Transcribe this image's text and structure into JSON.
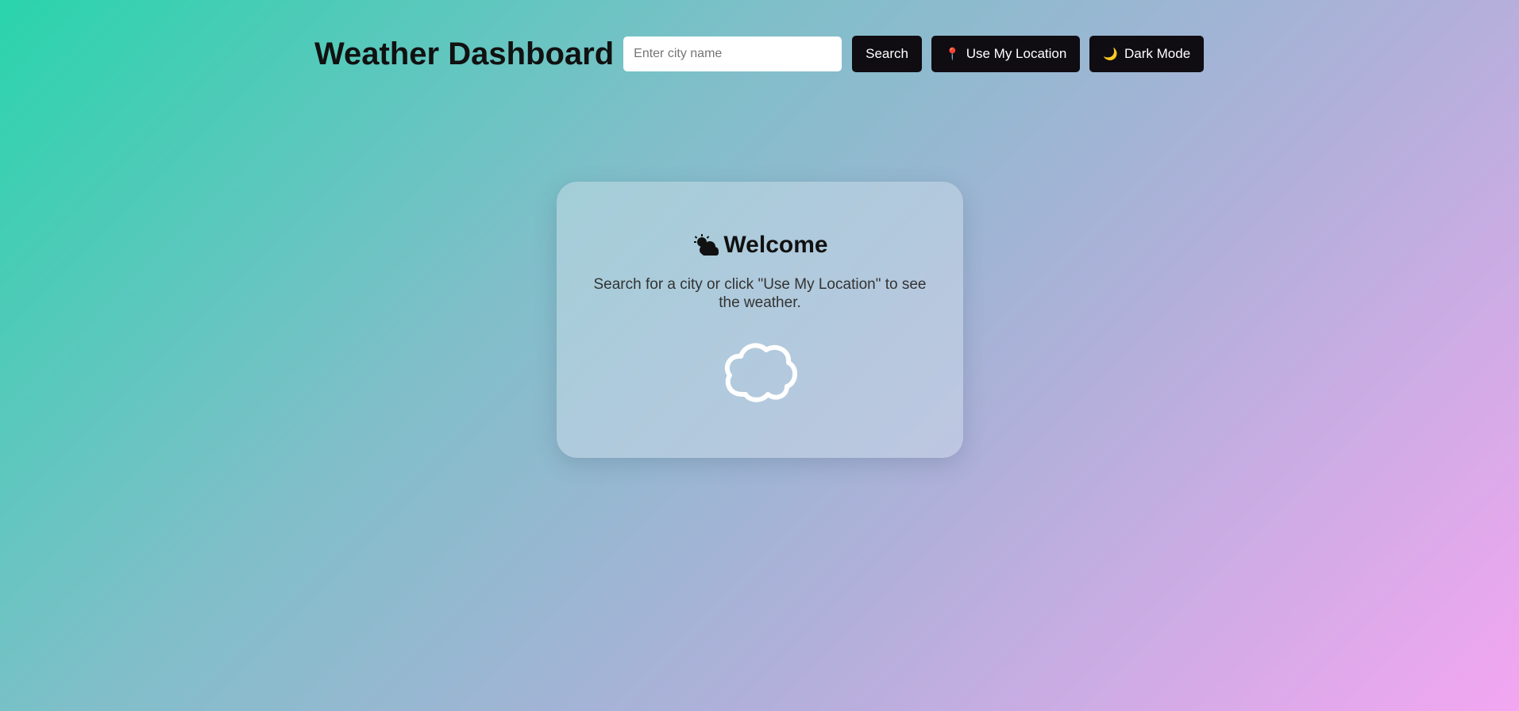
{
  "header": {
    "title": "Weather Dashboard",
    "search_placeholder": "Enter city name",
    "search_value": "",
    "search_button_label": "Search",
    "location_button_label": "Use My Location",
    "location_icon": "pin-icon",
    "dark_mode_button_label": "Dark Mode",
    "dark_mode_icon": "moon-icon"
  },
  "welcome": {
    "icon": "sun-behind-cloud-icon",
    "title": "Welcome",
    "message": "Search for a city or click \"Use My Location\" to see the weather.",
    "illustration": "cloud-icon"
  },
  "colors": {
    "button_bg": "#0f0c12",
    "gradient_start": "#2ad4ac",
    "gradient_end": "#f3a6f1",
    "pin": "#e2336b",
    "moon": "#f3c24a"
  }
}
